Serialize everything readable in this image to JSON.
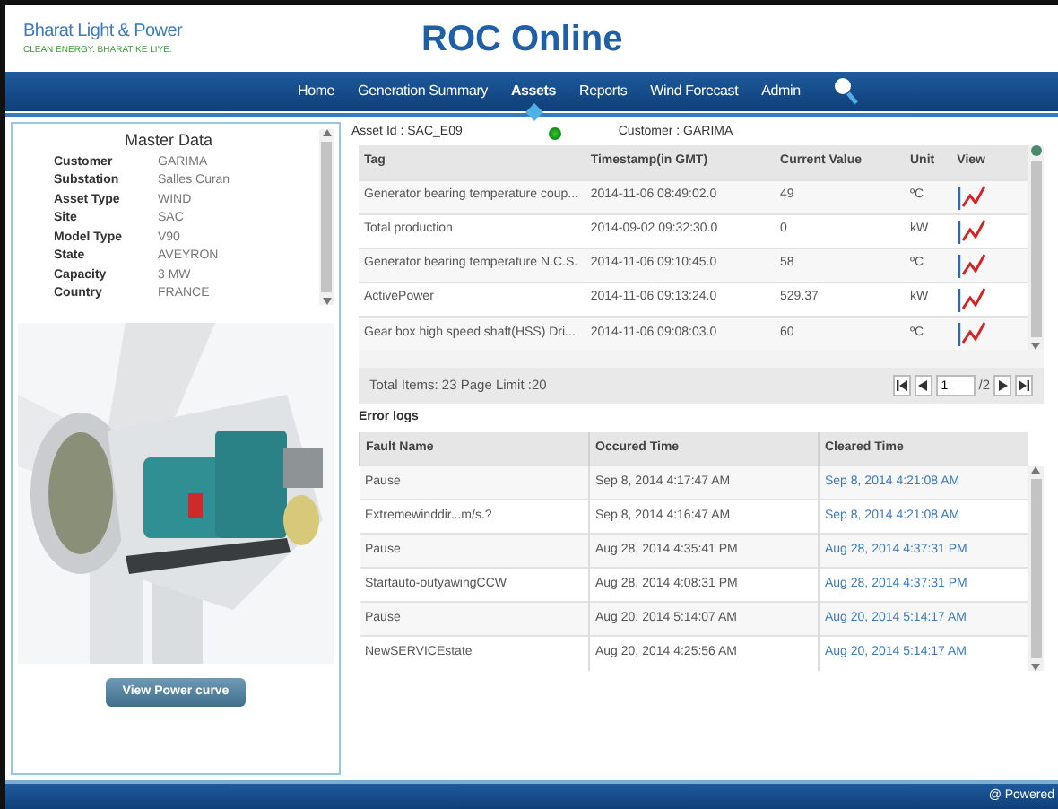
{
  "header": {
    "logo": "Bharat Light & Power",
    "tagline": "CLEAN ENERGY. BHARAT KE LIYE.",
    "title": "ROC Online"
  },
  "nav": [
    {
      "label": "Home",
      "selected": false
    },
    {
      "label": "Generation Summary",
      "selected": false
    },
    {
      "label": "Assets",
      "selected": true
    },
    {
      "label": "Reports",
      "selected": false
    },
    {
      "label": "Wind Forecast",
      "selected": false
    },
    {
      "label": "Admin",
      "selected": false
    }
  ],
  "master_data": {
    "title": "Master Data",
    "fields": [
      {
        "label": "Customer",
        "value": "GARIMA"
      },
      {
        "label": "Substation",
        "value": "Salles Curan"
      },
      {
        "label": "Asset Type",
        "value": "WIND"
      },
      {
        "label": "Site",
        "value": "SAC"
      },
      {
        "label": "Model Type",
        "value": "V90"
      },
      {
        "label": "State",
        "value": "AVEYRON"
      },
      {
        "label": "Capacity",
        "value": "3 MW"
      },
      {
        "label": "Country",
        "value": "FRANCE"
      }
    ]
  },
  "power_curve_button": "View Power curve",
  "asset": {
    "asset_id": "Asset Id : SAC_E09",
    "online": true,
    "customer": "Customer : GARIMA"
  },
  "tags_table": {
    "columns": [
      "Tag",
      "Timestamp(in GMT)",
      "Current Value",
      "Unit",
      "View"
    ],
    "rows": [
      {
        "tag": "Generator bearing temperature coup...",
        "timestamp": "2014-11-06 08:49:02.0",
        "value": "49",
        "unit": "ºC"
      },
      {
        "tag": "Total production",
        "timestamp": "2014-09-02 09:32:30.0",
        "value": "0",
        "unit": "kW"
      },
      {
        "tag": "Generator bearing temperature N.C.S.",
        "timestamp": "2014-11-06 09:10:45.0",
        "value": "58",
        "unit": "ºC"
      },
      {
        "tag": "ActivePower",
        "timestamp": "2014-11-06 09:13:24.0",
        "value": "529.37",
        "unit": "kW"
      },
      {
        "tag": "Gear box high speed shaft(HSS) Dri...",
        "timestamp": "2014-11-06 09:08:03.0",
        "value": "60",
        "unit": "ºC"
      }
    ],
    "footer": "Total Items: 23 Page Limit :20",
    "page": "1",
    "page_count": "/2"
  },
  "error_logs": {
    "title": "Error logs",
    "columns": [
      "Fault Name",
      "Occured Time",
      "Cleared Time"
    ],
    "rows": [
      {
        "fault": "Pause",
        "occured": "Sep 8, 2014 4:17:47 AM",
        "cleared": "Sep 8, 2014 4:21:08 AM"
      },
      {
        "fault": "Extremewinddir...m/s.?",
        "occured": "Sep 8, 2014 4:16:47 AM",
        "cleared": "Sep 8, 2014 4:21:08 AM"
      },
      {
        "fault": "Pause",
        "occured": "Aug 28, 2014 4:35:41 PM",
        "cleared": "Aug 28, 2014 4:37:31 PM"
      },
      {
        "fault": "Startauto-outyawingCCW",
        "occured": "Aug 28, 2014 4:08:31 PM",
        "cleared": "Aug 28, 2014 4:37:31 PM"
      },
      {
        "fault": "Pause",
        "occured": "Aug 20, 2014 5:14:07 AM",
        "cleared": "Aug 20, 2014 5:14:17 AM"
      },
      {
        "fault": "NewSERVICEstate",
        "occured": "Aug 20, 2014 4:25:56 AM",
        "cleared": "Aug 20, 2014 5:14:17 AM"
      }
    ]
  },
  "footer": "@ Powered"
}
